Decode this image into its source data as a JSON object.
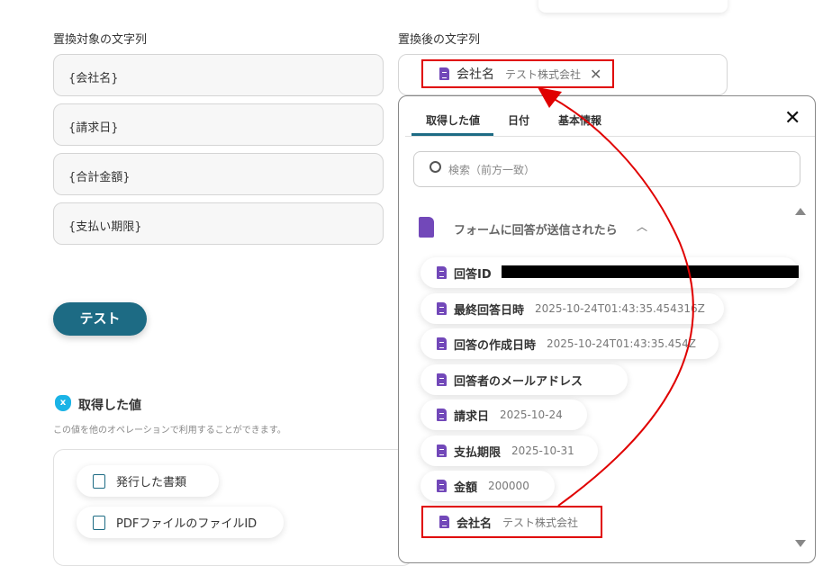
{
  "left": {
    "target_label": "置換対象の文字列",
    "targets": [
      "{会社名}",
      "{請求日}",
      "{合計金額}",
      "{支払い期限}"
    ],
    "test_button": "テスト",
    "acquired_title": "取得した値",
    "acquired_desc": "この値を他のオペレーションで利用することができます。",
    "outputs": [
      "発行した書類",
      "PDFファイルのファイルID"
    ]
  },
  "right": {
    "replace_label": "置換後の文字列",
    "selected_chip": {
      "key": "会社名",
      "value": "テスト株式会社"
    }
  },
  "popup": {
    "tabs": [
      "取得した値",
      "日付",
      "基本情報"
    ],
    "search_placeholder": "検索（前方一致）",
    "group_title": "フォームに回答が送信されたら",
    "items": [
      {
        "key": "回答ID",
        "value": ""
      },
      {
        "key": "最終回答日時",
        "value": "2025-10-24T01:43:35.454316Z"
      },
      {
        "key": "回答の作成日時",
        "value": "2025-10-24T01:43:35.454Z"
      },
      {
        "key": "回答者のメールアドレス",
        "value": ""
      },
      {
        "key": "請求日",
        "value": "2025-10-24"
      },
      {
        "key": "支払期限",
        "value": "2025-10-31"
      },
      {
        "key": "金額",
        "value": "200000"
      },
      {
        "key": "会社名",
        "value": "テスト株式会社"
      }
    ]
  },
  "colors": {
    "accent": "#1d6b84",
    "annotation": "#e00000",
    "form_icon": "#7248b9"
  }
}
